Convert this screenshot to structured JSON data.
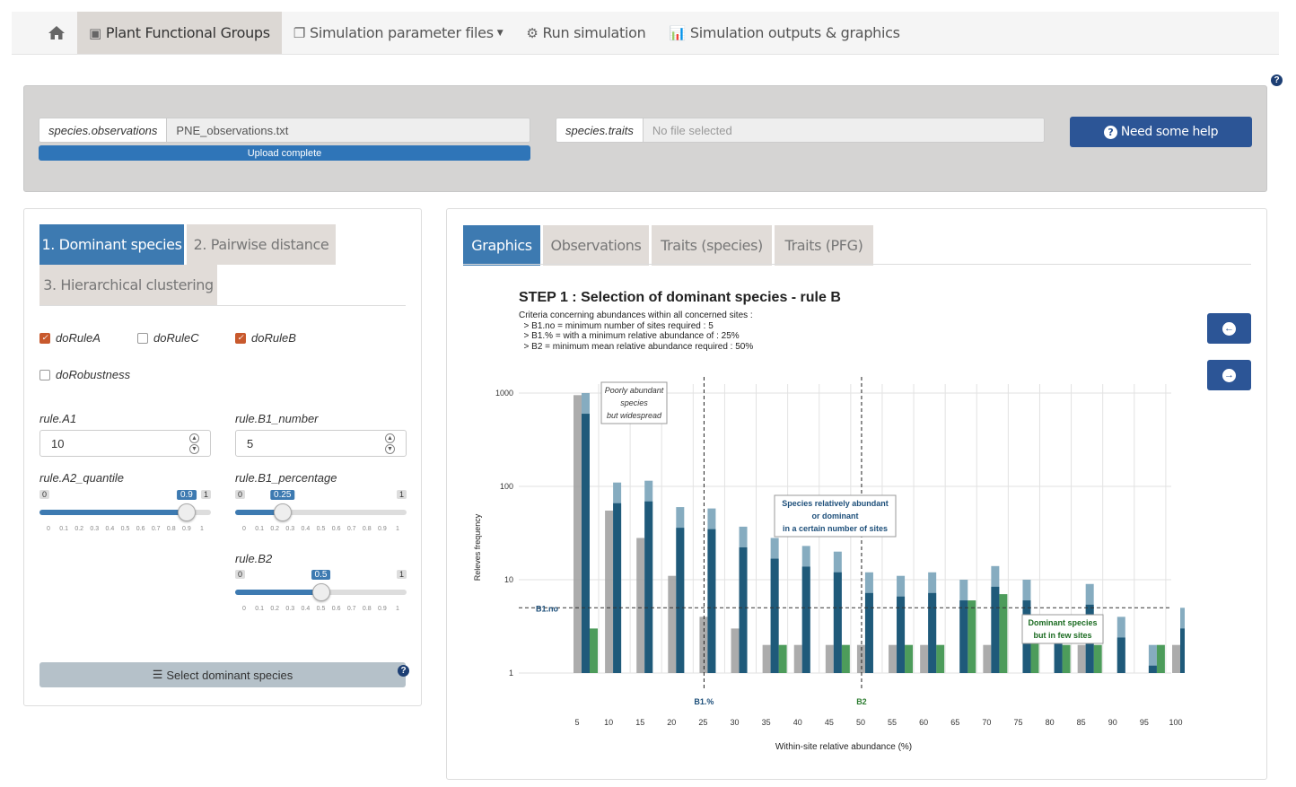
{
  "nav": {
    "home_icon": "home-icon",
    "items": [
      {
        "label": "Plant Functional Groups",
        "icon": "pfg-icon",
        "active": true
      },
      {
        "label": "Simulation parameter files",
        "icon": "files-icon",
        "dropdown": true
      },
      {
        "label": "Run simulation",
        "icon": "gears-icon"
      },
      {
        "label": "Simulation outputs & graphics",
        "icon": "barchart-icon"
      }
    ]
  },
  "upload": {
    "obs_label": "species.observations",
    "obs_value": "PNE_observations.txt",
    "progress_label": "Upload complete",
    "traits_label": "species.traits",
    "traits_value": "No file selected",
    "help_label": "Need some help"
  },
  "left": {
    "tabs": [
      "1. Dominant species",
      "2. Pairwise distance",
      "3. Hierarchical clustering"
    ],
    "checks": [
      {
        "label": "doRuleA",
        "checked": true
      },
      {
        "label": "doRuleC",
        "checked": false
      },
      {
        "label": "doRuleB",
        "checked": true
      },
      {
        "label": "doRobustness",
        "checked": false
      }
    ],
    "ruleA1": {
      "label": "rule.A1",
      "value": "10"
    },
    "ruleB1n": {
      "label": "rule.B1_number",
      "value": "5"
    },
    "ruleA2": {
      "label": "rule.A2_quantile",
      "min": "0",
      "max": "1",
      "value": "0.9",
      "fraction": 0.9
    },
    "ruleB1p": {
      "label": "rule.B1_percentage",
      "min": "0",
      "max": "1",
      "value": "0.25",
      "fraction": 0.25
    },
    "ruleB2": {
      "label": "rule.B2",
      "min": "0",
      "max": "1",
      "value": "0.5",
      "fraction": 0.5
    },
    "ticks": [
      "0",
      "0.1",
      "0.2",
      "0.3",
      "0.4",
      "0.5",
      "0.6",
      "0.7",
      "0.8",
      "0.9",
      "1"
    ],
    "select_label": "Select dominant species"
  },
  "right": {
    "tabs": [
      "Graphics",
      "Observations",
      "Traits (species)",
      "Traits (PFG)"
    ],
    "title": "STEP 1 : Selection of dominant species - rule B",
    "criteria": [
      "Criteria concerning abundances within all concerned sites :",
      "  > B1.no = minimum number of sites required : 5",
      "  > B1.% = with a minimum relative abundance of : 25%",
      "  > B2 = minimum mean relative abundance required : 50%"
    ]
  },
  "chart_data": {
    "type": "bar",
    "xlabel": "Within-site relative abundance (%)",
    "ylabel": "Releves frequency",
    "y_scale": "log",
    "ylim": [
      1,
      1200
    ],
    "y_ticks": [
      "1",
      "10",
      "100",
      "1000"
    ],
    "categories": [
      "5",
      "10",
      "15",
      "20",
      "25",
      "30",
      "35",
      "40",
      "45",
      "50",
      "55",
      "60",
      "65",
      "70",
      "75",
      "80",
      "85",
      "90",
      "95",
      "100"
    ],
    "series": [
      {
        "color": "#9e9e9e",
        "values": [
          950,
          55,
          28,
          11,
          4,
          3,
          2,
          2,
          2,
          2,
          2,
          2,
          1,
          2,
          1,
          1,
          2,
          1,
          1,
          2
        ]
      },
      {
        "color": "#7fa8bd",
        "values": [
          1000,
          110,
          115,
          60,
          58,
          37,
          28,
          23,
          20,
          12,
          11,
          12,
          10,
          14,
          10,
          4,
          9,
          4,
          2,
          5
        ]
      },
      {
        "color": "#2e8b3e",
        "values": [
          3,
          1,
          1,
          1,
          1,
          1,
          2,
          1,
          2,
          1,
          2,
          2,
          6,
          7,
          4,
          2,
          2,
          1,
          2,
          2
        ]
      }
    ],
    "hlines": [
      {
        "label": "B1.no",
        "y": 5
      }
    ],
    "vlines": [
      {
        "label": "B1.%",
        "x": 25
      },
      {
        "label": "B2",
        "x": 50
      }
    ],
    "annotations": [
      "Poorly abundant species but widespread",
      "Species relatively abundant or dominant in a certain number of sites",
      "Dominant species but in few sites"
    ],
    "grid": true
  }
}
